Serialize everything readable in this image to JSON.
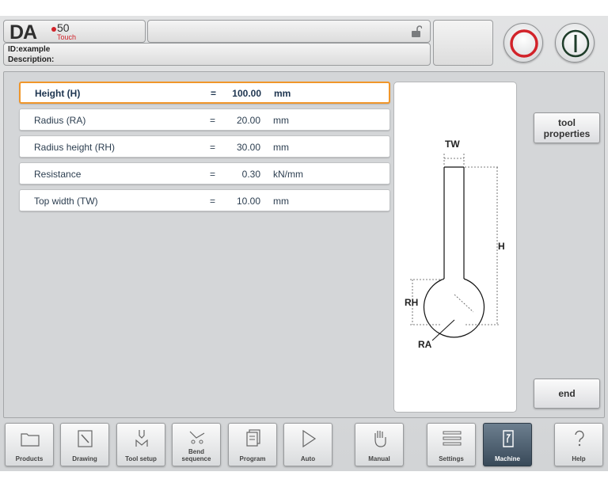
{
  "header": {
    "logo": {
      "brand": "DA",
      "model": "50",
      "edition": "Touch"
    },
    "info": {
      "id": "ID:example",
      "description": "Description:"
    }
  },
  "params": [
    {
      "name": "Height (H)",
      "eq": "=",
      "value": "100.00",
      "unit": "mm",
      "selected": true
    },
    {
      "name": "Radius (RA)",
      "eq": "=",
      "value": "20.00",
      "unit": "mm"
    },
    {
      "name": "Radius height (RH)",
      "eq": "=",
      "value": "30.00",
      "unit": "mm"
    },
    {
      "name": "Resistance",
      "eq": "=",
      "value": "0.30",
      "unit": "kN/mm"
    },
    {
      "name": "Top width (TW)",
      "eq": "=",
      "value": "10.00",
      "unit": "mm"
    }
  ],
  "drawing": {
    "labels": {
      "tw": "TW",
      "h": "H",
      "rh": "RH",
      "ra": "RA"
    }
  },
  "side_buttons": {
    "tool_properties_line1": "tool",
    "tool_properties_line2": "properties",
    "end": "end"
  },
  "nav": [
    {
      "label1": "Products",
      "label2": "",
      "icon": "folder-icon"
    },
    {
      "label1": "Drawing",
      "label2": "",
      "icon": "pencil-icon"
    },
    {
      "label1": "Tool setup",
      "label2": "",
      "icon": "tool-setup-icon"
    },
    {
      "label1": "Bend",
      "label2": "sequence",
      "icon": "bend-sequence-icon"
    },
    {
      "label1": "Program",
      "label2": "",
      "icon": "program-icon"
    },
    {
      "label1": "Auto",
      "label2": "",
      "icon": "play-icon"
    },
    {
      "label1": "Manual",
      "label2": "",
      "icon": "hand-icon"
    },
    {
      "label1": "Settings",
      "label2": "",
      "icon": "settings-list-icon"
    },
    {
      "label1": "Machine",
      "label2": "",
      "icon": "machine-icon",
      "active": true
    },
    {
      "label1": "Help",
      "label2": "",
      "icon": "help-icon"
    }
  ],
  "colors": {
    "selection": "#f0962a",
    "stop": "#d2232a",
    "start": "#1f3d2a",
    "active_tab": "#394a59"
  }
}
